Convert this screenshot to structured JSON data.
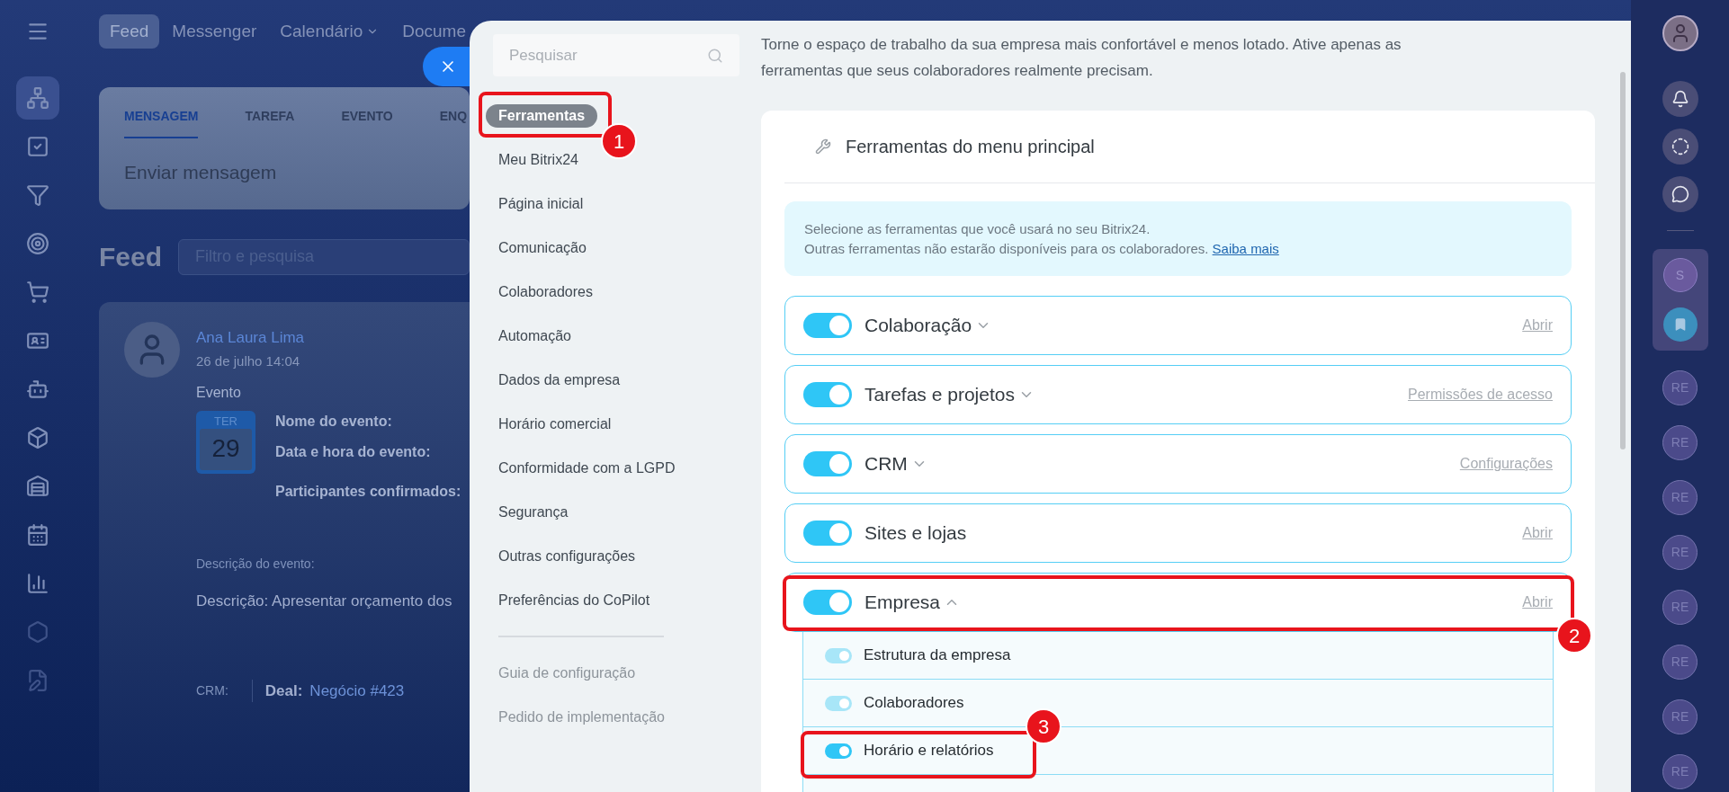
{
  "top_nav": [
    {
      "label": "Feed",
      "selected": true,
      "dropdown": false
    },
    {
      "label": "Messenger",
      "selected": false,
      "dropdown": false
    },
    {
      "label": "Calendário",
      "selected": false,
      "dropdown": true
    },
    {
      "label": "Docume",
      "selected": false,
      "dropdown": false
    }
  ],
  "composer": {
    "tabs": [
      {
        "label": "MENSAGEM",
        "selected": true
      },
      {
        "label": "TAREFA",
        "selected": false
      },
      {
        "label": "EVENTO",
        "selected": false
      },
      {
        "label": "ENQ",
        "selected": false
      }
    ],
    "placeholder": "Enviar mensagem"
  },
  "feed": {
    "title": "Feed",
    "filter_placeholder": "Filtro e pesquisa"
  },
  "post": {
    "author": "Ana Laura Lima",
    "date": "26 de julho 14:04",
    "type": "Evento",
    "calendar_day": "TER",
    "calendar_date": "29",
    "fields": [
      "Nome do evento:",
      "Data e hora do evento:",
      "Participantes confirmados:"
    ],
    "description_label": "Descrição do evento:",
    "description": "Descrição: Apresentar orçamento dos",
    "crm_label": "CRM:",
    "deal_label": "Deal:",
    "deal_value": "Negócio #423"
  },
  "settings": {
    "search_placeholder": "Pesquisar",
    "menu": [
      {
        "label": "Ferramentas",
        "selected": true
      },
      {
        "label": "Meu Bitrix24",
        "selected": false
      },
      {
        "label": "Página inicial",
        "selected": false
      },
      {
        "label": "Comunicação",
        "selected": false
      },
      {
        "label": "Colaboradores",
        "selected": false
      },
      {
        "label": "Automação",
        "selected": false
      },
      {
        "label": "Dados da empresa",
        "selected": false
      },
      {
        "label": "Horário comercial",
        "selected": false
      },
      {
        "label": "Conformidade com a LGPD",
        "selected": false
      },
      {
        "label": "Segurança",
        "selected": false
      },
      {
        "label": "Outras configurações",
        "selected": false
      },
      {
        "label": "Preferências do CoPilot",
        "selected": false
      }
    ],
    "footer_links": [
      "Guia de configuração",
      "Pedido de implementação"
    ]
  },
  "intro": "Torne o espaço de trabalho da sua empresa mais confortável e menos lotado. Ative apenas as ferramentas que seus colaboradores realmente precisam.",
  "card": {
    "title": "Ferramentas do menu principal",
    "info_lines": [
      "Selecione as ferramentas que você usará no seu Bitrix24.",
      "Outras ferramentas não estarão disponíveis para os colaboradores."
    ],
    "info_link": "Saiba mais",
    "tools": [
      {
        "label": "Colaboração",
        "on": true,
        "expanded": false,
        "action": "Abrir"
      },
      {
        "label": "Tarefas e projetos",
        "on": true,
        "expanded": false,
        "action": "Permissões de acesso"
      },
      {
        "label": "CRM",
        "on": true,
        "expanded": false,
        "action": "Configurações"
      },
      {
        "label": "Sites e lojas",
        "on": true,
        "action": "Abrir"
      },
      {
        "label": "Empresa",
        "on": true,
        "expanded": true,
        "action": "Abrir",
        "children": [
          {
            "label": "Estrutura da empresa",
            "on": true,
            "disabled": true
          },
          {
            "label": "Colaboradores",
            "on": true,
            "disabled": true
          },
          {
            "label": "Horário e relatórios",
            "on": true,
            "disabled": false
          }
        ]
      }
    ]
  },
  "annotations": [
    "1",
    "2",
    "3"
  ],
  "right_rail": {
    "pinned": [
      {
        "kind": "initials",
        "text": "S"
      },
      {
        "kind": "bookmark"
      }
    ],
    "chats": [
      "RE",
      "RE",
      "RE",
      "RE",
      "RE",
      "RE",
      "RE",
      "RE"
    ]
  }
}
